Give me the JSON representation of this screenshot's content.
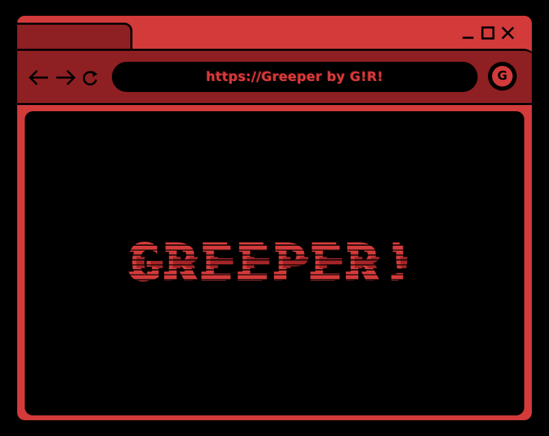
{
  "window": {
    "controls": [
      "minimize-icon",
      "maximize-icon",
      "close-icon"
    ]
  },
  "toolbar": {
    "nav_icons": [
      "arrow-left-icon",
      "arrow-right-icon",
      "refresh-icon"
    ],
    "address": "https://Greeper by G!R!",
    "profile_letter": "G"
  },
  "content": {
    "title": "GREEPER!"
  },
  "colors": {
    "accent": "#d33a3a",
    "dark_accent": "#8e1f22",
    "background": "#000000"
  }
}
